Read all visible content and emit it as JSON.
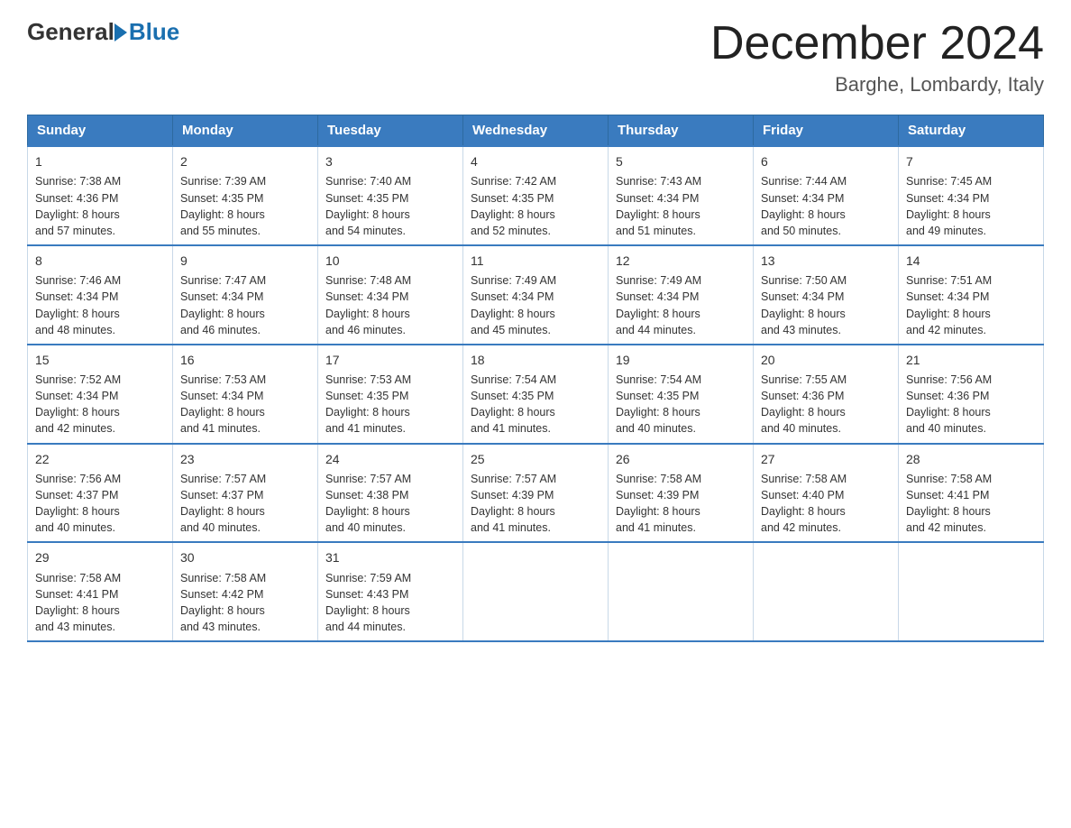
{
  "logo": {
    "general": "General",
    "blue": "Blue"
  },
  "header": {
    "month": "December 2024",
    "location": "Barghe, Lombardy, Italy"
  },
  "weekdays": [
    "Sunday",
    "Monday",
    "Tuesday",
    "Wednesday",
    "Thursday",
    "Friday",
    "Saturday"
  ],
  "weeks": [
    [
      {
        "day": "1",
        "sunrise": "7:38 AM",
        "sunset": "4:36 PM",
        "daylight": "8 hours and 57 minutes."
      },
      {
        "day": "2",
        "sunrise": "7:39 AM",
        "sunset": "4:35 PM",
        "daylight": "8 hours and 55 minutes."
      },
      {
        "day": "3",
        "sunrise": "7:40 AM",
        "sunset": "4:35 PM",
        "daylight": "8 hours and 54 minutes."
      },
      {
        "day": "4",
        "sunrise": "7:42 AM",
        "sunset": "4:35 PM",
        "daylight": "8 hours and 52 minutes."
      },
      {
        "day": "5",
        "sunrise": "7:43 AM",
        "sunset": "4:34 PM",
        "daylight": "8 hours and 51 minutes."
      },
      {
        "day": "6",
        "sunrise": "7:44 AM",
        "sunset": "4:34 PM",
        "daylight": "8 hours and 50 minutes."
      },
      {
        "day": "7",
        "sunrise": "7:45 AM",
        "sunset": "4:34 PM",
        "daylight": "8 hours and 49 minutes."
      }
    ],
    [
      {
        "day": "8",
        "sunrise": "7:46 AM",
        "sunset": "4:34 PM",
        "daylight": "8 hours and 48 minutes."
      },
      {
        "day": "9",
        "sunrise": "7:47 AM",
        "sunset": "4:34 PM",
        "daylight": "8 hours and 46 minutes."
      },
      {
        "day": "10",
        "sunrise": "7:48 AM",
        "sunset": "4:34 PM",
        "daylight": "8 hours and 46 minutes."
      },
      {
        "day": "11",
        "sunrise": "7:49 AM",
        "sunset": "4:34 PM",
        "daylight": "8 hours and 45 minutes."
      },
      {
        "day": "12",
        "sunrise": "7:49 AM",
        "sunset": "4:34 PM",
        "daylight": "8 hours and 44 minutes."
      },
      {
        "day": "13",
        "sunrise": "7:50 AM",
        "sunset": "4:34 PM",
        "daylight": "8 hours and 43 minutes."
      },
      {
        "day": "14",
        "sunrise": "7:51 AM",
        "sunset": "4:34 PM",
        "daylight": "8 hours and 42 minutes."
      }
    ],
    [
      {
        "day": "15",
        "sunrise": "7:52 AM",
        "sunset": "4:34 PM",
        "daylight": "8 hours and 42 minutes."
      },
      {
        "day": "16",
        "sunrise": "7:53 AM",
        "sunset": "4:34 PM",
        "daylight": "8 hours and 41 minutes."
      },
      {
        "day": "17",
        "sunrise": "7:53 AM",
        "sunset": "4:35 PM",
        "daylight": "8 hours and 41 minutes."
      },
      {
        "day": "18",
        "sunrise": "7:54 AM",
        "sunset": "4:35 PM",
        "daylight": "8 hours and 41 minutes."
      },
      {
        "day": "19",
        "sunrise": "7:54 AM",
        "sunset": "4:35 PM",
        "daylight": "8 hours and 40 minutes."
      },
      {
        "day": "20",
        "sunrise": "7:55 AM",
        "sunset": "4:36 PM",
        "daylight": "8 hours and 40 minutes."
      },
      {
        "day": "21",
        "sunrise": "7:56 AM",
        "sunset": "4:36 PM",
        "daylight": "8 hours and 40 minutes."
      }
    ],
    [
      {
        "day": "22",
        "sunrise": "7:56 AM",
        "sunset": "4:37 PM",
        "daylight": "8 hours and 40 minutes."
      },
      {
        "day": "23",
        "sunrise": "7:57 AM",
        "sunset": "4:37 PM",
        "daylight": "8 hours and 40 minutes."
      },
      {
        "day": "24",
        "sunrise": "7:57 AM",
        "sunset": "4:38 PM",
        "daylight": "8 hours and 40 minutes."
      },
      {
        "day": "25",
        "sunrise": "7:57 AM",
        "sunset": "4:39 PM",
        "daylight": "8 hours and 41 minutes."
      },
      {
        "day": "26",
        "sunrise": "7:58 AM",
        "sunset": "4:39 PM",
        "daylight": "8 hours and 41 minutes."
      },
      {
        "day": "27",
        "sunrise": "7:58 AM",
        "sunset": "4:40 PM",
        "daylight": "8 hours and 42 minutes."
      },
      {
        "day": "28",
        "sunrise": "7:58 AM",
        "sunset": "4:41 PM",
        "daylight": "8 hours and 42 minutes."
      }
    ],
    [
      {
        "day": "29",
        "sunrise": "7:58 AM",
        "sunset": "4:41 PM",
        "daylight": "8 hours and 43 minutes."
      },
      {
        "day": "30",
        "sunrise": "7:58 AM",
        "sunset": "4:42 PM",
        "daylight": "8 hours and 43 minutes."
      },
      {
        "day": "31",
        "sunrise": "7:59 AM",
        "sunset": "4:43 PM",
        "daylight": "8 hours and 44 minutes."
      },
      null,
      null,
      null,
      null
    ]
  ]
}
